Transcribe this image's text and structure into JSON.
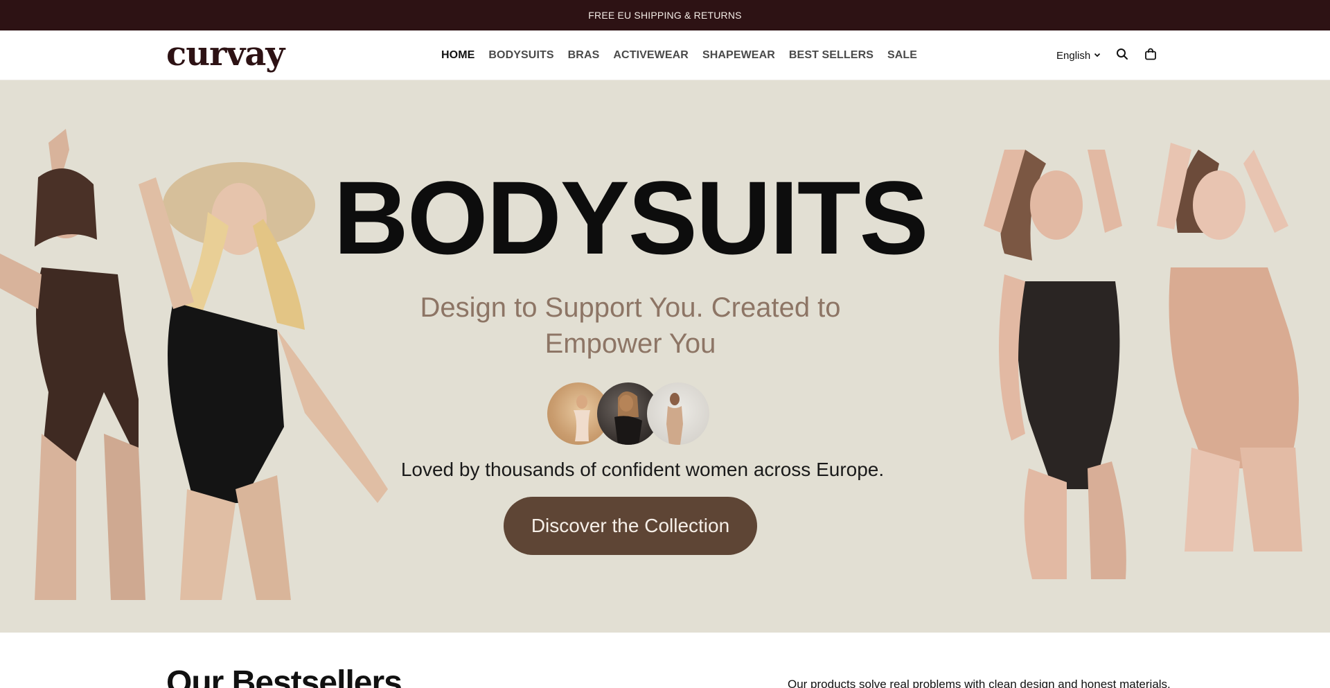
{
  "announcement": {
    "text": "FREE EU SHIPPING & RETURNS"
  },
  "header": {
    "logo": "curvay",
    "nav": [
      {
        "label": "HOME",
        "active": true
      },
      {
        "label": "BODYSUITS",
        "active": false
      },
      {
        "label": "BRAS",
        "active": false
      },
      {
        "label": "ACTIVEWEAR",
        "active": false
      },
      {
        "label": "SHAPEWEAR",
        "active": false
      },
      {
        "label": "BEST SELLERS",
        "active": false
      },
      {
        "label": "SALE",
        "active": false
      }
    ],
    "language": "English",
    "icons": {
      "language": "chevron-down-icon",
      "search": "search-icon",
      "cart": "shopping-bag-icon"
    }
  },
  "hero": {
    "title": "BODYSUITS",
    "subtitle": "Design to Support You. Created to Empower You",
    "tagline": "Loved by thousands of confident women across Europe.",
    "cta": "Discover the Collection",
    "colors": {
      "background": "#e2dfd3",
      "button": "#5e4535",
      "subtitle": "#8d7565"
    }
  },
  "bestsellers": {
    "title": "Our Bestsellers",
    "description": "Our products solve real problems with clean design and honest materials."
  },
  "colors": {
    "announcement_bg": "#2d1214",
    "brand": "#2d1214"
  }
}
